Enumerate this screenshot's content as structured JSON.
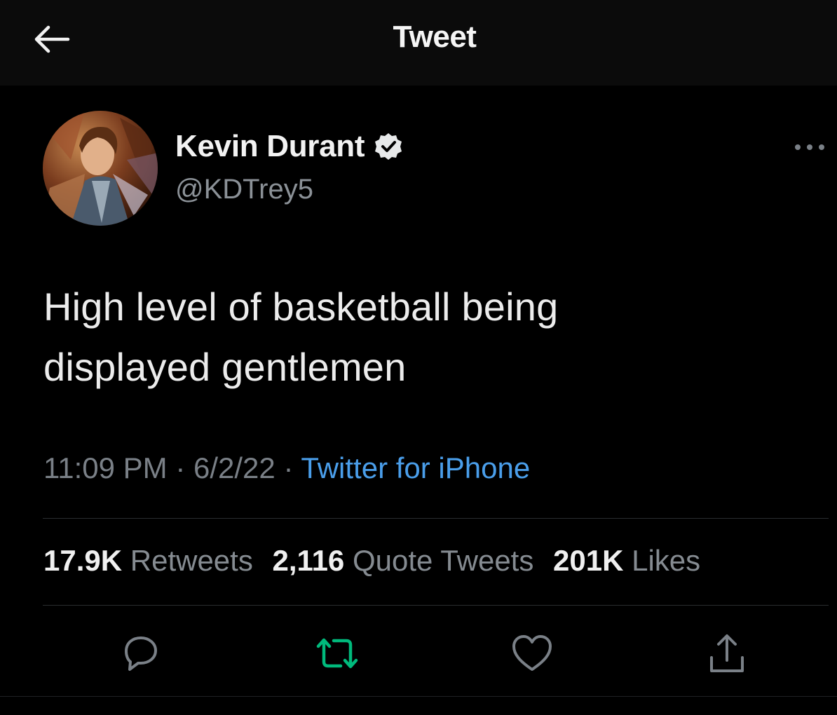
{
  "header": {
    "title": "Tweet",
    "back_icon": "arrow-left-icon"
  },
  "author": {
    "display_name": "Kevin Durant",
    "handle": "@KDTrey5",
    "verified": true,
    "verified_icon": "verified-badge-icon"
  },
  "tweet": {
    "text_line_1": "High level of basketball being",
    "text_line_2": "displayed gentlemen",
    "time": "11:09 PM",
    "date": "6/2/22",
    "separator": "·",
    "source": "Twitter for iPhone"
  },
  "stats": {
    "retweets_count": "17.9K",
    "retweets_label": "Retweets",
    "quotes_count": "2,116",
    "quotes_label": "Quote Tweets",
    "likes_count": "201K",
    "likes_label": "Likes"
  },
  "actions": [
    {
      "name": "reply",
      "icon": "reply-icon"
    },
    {
      "name": "retweet",
      "icon": "retweet-icon",
      "active": true
    },
    {
      "name": "like",
      "icon": "heart-icon"
    },
    {
      "name": "share",
      "icon": "share-icon"
    }
  ],
  "colors": {
    "background": "#000000",
    "link": "#4a9eea",
    "retweet_active": "#00ba7c",
    "muted_text": "#8b9197",
    "primary_text": "#e7e9ea"
  }
}
